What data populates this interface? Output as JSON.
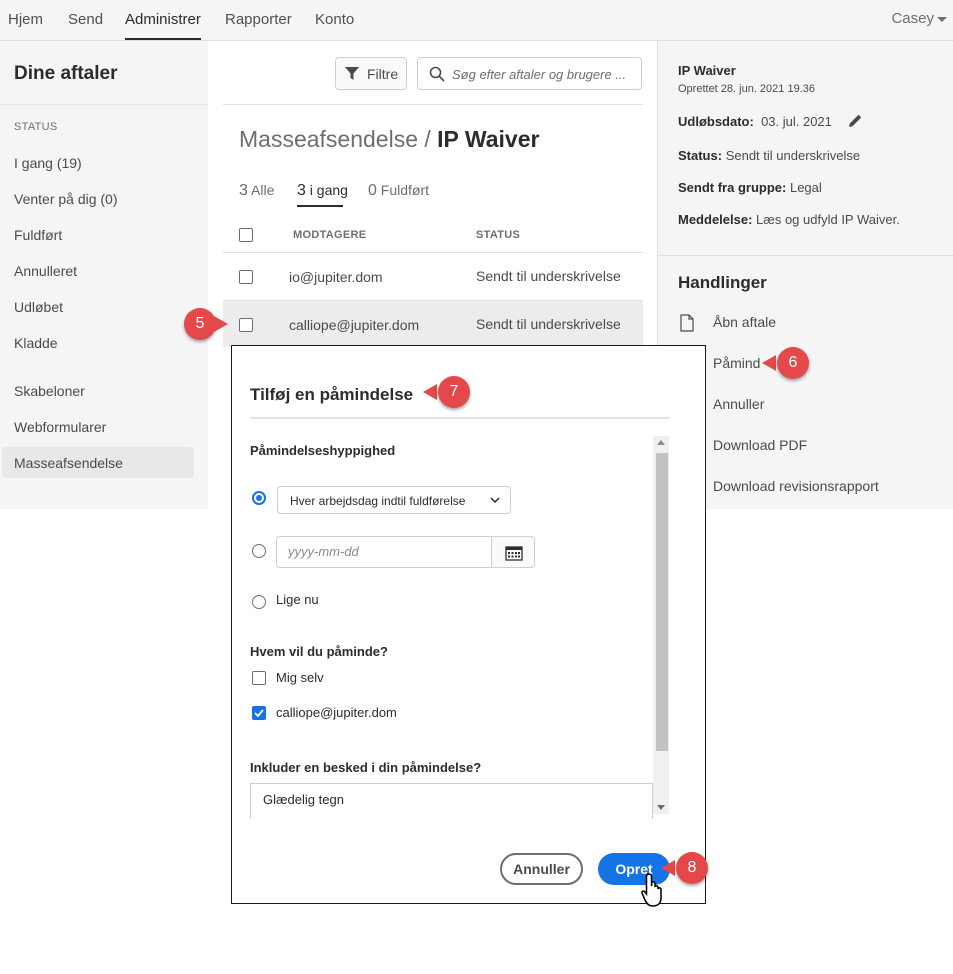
{
  "nav": {
    "items": [
      "Hjem",
      "Send",
      "Administrer",
      "Rapporter",
      "Konto"
    ],
    "active": "Administrer",
    "user": "Casey"
  },
  "sidebar": {
    "title": "Dine aftaler",
    "status_heading": "STATUS",
    "items": [
      "I gang (19)",
      "Venter på dig (0)",
      "Fuldført",
      "Annulleret",
      "Udløbet",
      "Kladde"
    ],
    "secondary": [
      "Skabeloner",
      "Webformularer",
      "Masseafsendelse"
    ],
    "selected": "Masseafsendelse"
  },
  "toolbar": {
    "filter_label": "Filtre",
    "search_placeholder": "Søg efter aftaler og brugere ..."
  },
  "main": {
    "title_prefix": "Masseafsendelse / ",
    "title_bold": "IP Waiver",
    "tabs": [
      {
        "count": "3",
        "label": "Alle"
      },
      {
        "count": "3",
        "label": "i gang"
      },
      {
        "count": "0",
        "label": "Fuldført"
      }
    ],
    "columns": [
      "MODTAGERE",
      "STATUS"
    ],
    "rows": [
      {
        "recipient": "io@jupiter.dom",
        "status": "Sendt til underskrivelse"
      },
      {
        "recipient": "calliope@jupiter.dom",
        "status": "Sendt til underskrivelse"
      }
    ]
  },
  "details": {
    "name": "IP Waiver",
    "created": "Oprettet 28. jun. 2021 19.36",
    "expiry_label": "Udløbsdato:",
    "expiry_value": "03. jul. 2021",
    "status_label": "Status:",
    "status_value": "Sendt til underskrivelse",
    "group_label": "Sendt fra gruppe:",
    "group_value": "Legal",
    "message_label": "Meddelelse:",
    "message_value": "Læs og udfyld IP Waiver.",
    "actions_title": "Handlinger",
    "actions": [
      "Åbn aftale",
      "Påmind",
      "Annuller",
      "Download PDF",
      "Download revisionsrapport"
    ]
  },
  "dialog": {
    "title": "Tilføj en påmindelse",
    "frequency_label": "Påmindelseshyppighed",
    "frequency_value": "Hver arbejdsdag indtil fuldførelse",
    "date_placeholder": "yyyy-mm-dd",
    "now_label": "Lige nu",
    "who_label": "Hvem vil du påminde?",
    "recipients": [
      {
        "label": "Mig selv",
        "checked": false
      },
      {
        "label": "calliope@jupiter.dom",
        "checked": true
      }
    ],
    "message_label": "Inkluder en besked i din påmindelse?",
    "message_value": "Glædelig tegn",
    "cancel_label": "Annuller",
    "create_label": "Opret"
  },
  "callouts": [
    "5",
    "6",
    "7",
    "8"
  ],
  "colors": {
    "accent": "#1473e6",
    "callout": "#e3494a",
    "panel_bg": "#f5f5f5"
  }
}
